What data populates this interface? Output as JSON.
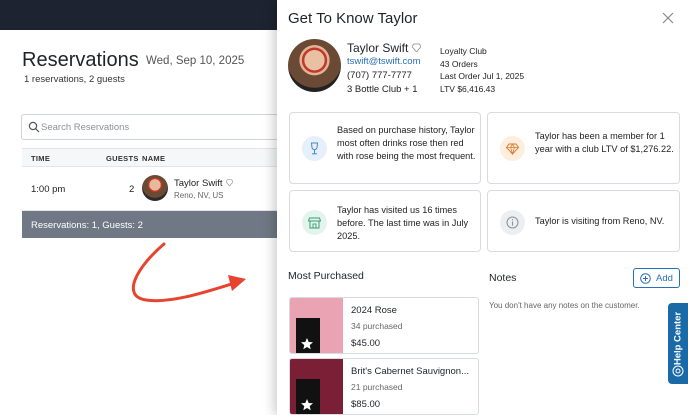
{
  "background_page": {
    "title": "Reservations",
    "date": "Wed, Sep 10, 2025",
    "summary": "1 reservations, 2 guests",
    "search_placeholder": "Search Reservations",
    "columns": [
      "TIME",
      "GUESTS",
      "NAME"
    ],
    "rows": [
      {
        "time": "1:00 pm",
        "guests": "2",
        "name": "Taylor Swift",
        "location": "Reno, NV, US"
      }
    ],
    "footer": "Reservations: 1, Guests: 2"
  },
  "drawer": {
    "title": "Get To Know Taylor",
    "guest": {
      "name": "Taylor Swift",
      "email": "tswift@tswift.com",
      "phone": "(707) 777-7777",
      "club": "3 Bottle Club + 1"
    },
    "stats": {
      "loyalty": "Loyalty Club",
      "orders": "43 Orders",
      "last_order": "Last Order Jul 1, 2025",
      "ltv": "LTV  $6,416.43"
    },
    "insights": [
      {
        "icon": "wine-glass-icon",
        "text": "Based on purchase history, Taylor most often drinks rose then red with rose being the most frequent."
      },
      {
        "icon": "diamond-icon",
        "text": "Taylor has been a member for 1 year with a club LTV of $1,276.22."
      },
      {
        "icon": "store-icon",
        "text": "Taylor has visited us 16 times before. The last time was in July 2025."
      },
      {
        "icon": "info-icon",
        "text": "Taylor is visiting from Reno, NV."
      }
    ],
    "most_purchased_title": "Most Purchased",
    "products": [
      {
        "name": "2024 Rose",
        "purchased": "34 purchased",
        "price": "$45.00"
      },
      {
        "name": "Brit's Cabernet Sauvignon...",
        "purchased": "21 purchased",
        "price": "$85.00"
      }
    ],
    "notes_title": "Notes",
    "add_label": "Add",
    "notes_empty": "You don't have any notes on the customer.",
    "help_label": "Help Center"
  },
  "colors": {
    "topbar": "#1d2330",
    "footer_bar": "#6f7884",
    "link": "#2a6fb7",
    "arrow": "#e8432e",
    "help_tab": "#1b6aa8"
  }
}
